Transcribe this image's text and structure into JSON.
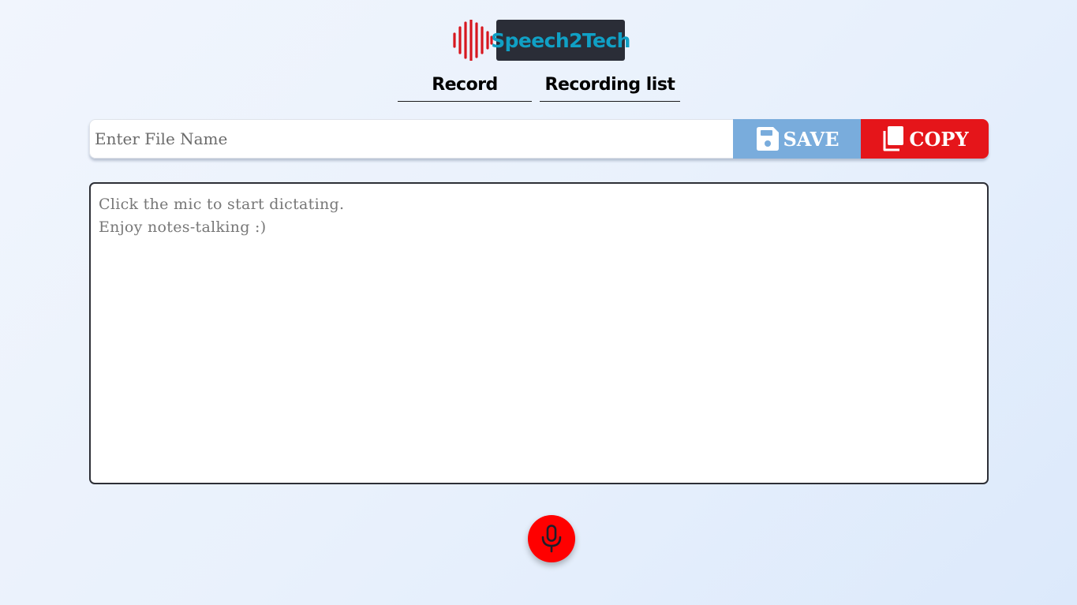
{
  "brand": {
    "name": "Speech2Tech"
  },
  "tabs": [
    {
      "label": "Record"
    },
    {
      "label": "Recording list"
    }
  ],
  "file": {
    "placeholder": "Enter File Name",
    "value": ""
  },
  "buttons": {
    "save_label": "SAVE",
    "copy_label": "COPY"
  },
  "notes": {
    "lines": [
      "Click the mic to start dictating.",
      "Enjoy notes-talking :)"
    ]
  },
  "icons": {
    "logo": "sound-wave-icon",
    "save": "floppy-disk-icon",
    "copy": "copy-icon",
    "mic": "microphone-icon"
  },
  "colors": {
    "brand_text": "#10a0c5",
    "brand_bg": "#2a2d37",
    "wave": "#d7171f",
    "save": "#79acdc",
    "copy": "#e5151a",
    "mic": "#ff0000"
  }
}
